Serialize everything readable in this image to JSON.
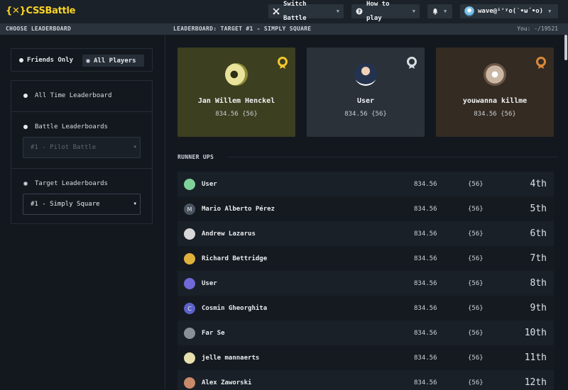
{
  "app": {
    "logo_symbol": "{✕}",
    "logo_text": "CSSBattle",
    "brand_color": "#f9d423"
  },
  "nav": {
    "switch_battle": "Switch Battle",
    "how_to_play": "How to play",
    "username": "wave@ⁱ'ʸo(ˋ•ω´•o)"
  },
  "subheader": {
    "choose": "CHOOSE LEADERBOARD",
    "current": "LEADERBOARD: TARGET #1 - SIMPLY SQUARE",
    "you": "You: -/19521"
  },
  "sidebar": {
    "friends_only": "Friends Only",
    "all_players": "All Players",
    "all_time": "All Time Leaderboard",
    "battle": "Battle Leaderboards",
    "battle_select": "#1 - Pilot Battle",
    "target": "Target Leaderboards",
    "target_select": "#1 - Simply Square"
  },
  "podium": [
    {
      "name": "Jan Willem Henckel",
      "score": "834.56 {56}",
      "medal": "gold",
      "color": "#3c3f20"
    },
    {
      "name": "User",
      "score": "834.56 {56}",
      "medal": "silver",
      "color": "#2b3139"
    },
    {
      "name": "youwanna killme",
      "score": "834.56 {56}",
      "medal": "bronze",
      "color": "#342b22"
    }
  ],
  "runner_ups_title": "RUNNER UPS",
  "runners": [
    {
      "name": "User",
      "score": "834.56",
      "count": "{56}",
      "rank": "4th",
      "avatar": "#7fd19a"
    },
    {
      "name": "Mario Alberto Pérez",
      "score": "834.56",
      "count": "{56}",
      "rank": "5th",
      "avatar": "#4a5461",
      "initial": "M"
    },
    {
      "name": "Andrew Lazarus",
      "score": "834.56",
      "count": "{56}",
      "rank": "6th",
      "avatar": "#d8d8d8"
    },
    {
      "name": "Richard Bettridge",
      "score": "834.56",
      "count": "{56}",
      "rank": "7th",
      "avatar": "#e0b13c"
    },
    {
      "name": "User",
      "score": "834.56",
      "count": "{56}",
      "rank": "8th",
      "avatar": "#6f6ad8"
    },
    {
      "name": "Cosmin Gheorghita",
      "score": "834.56",
      "count": "{56}",
      "rank": "9th",
      "avatar": "#5c62c8",
      "initial": "C"
    },
    {
      "name": "Far Se",
      "score": "834.56",
      "count": "{56}",
      "rank": "10th",
      "avatar": "#8a9096"
    },
    {
      "name": "jelle mannaerts",
      "score": "834.56",
      "count": "{56}",
      "rank": "11th",
      "avatar": "#e6dfae"
    },
    {
      "name": "Alex Zaworski",
      "score": "834.56",
      "count": "{56}",
      "rank": "12th",
      "avatar": "#c98a6a"
    }
  ]
}
